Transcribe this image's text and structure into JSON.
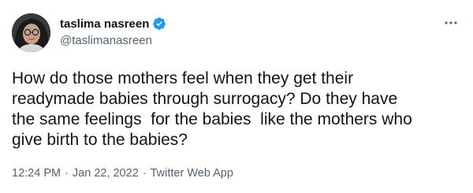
{
  "author": {
    "display_name": "taslima nasreen",
    "handle": "@taslimanasreen",
    "verified": true,
    "avatar_icon": "profile-photo",
    "verified_icon": "verified-badge-icon"
  },
  "menu": {
    "icon": "more-icon"
  },
  "tweet": {
    "text": "How do those mothers feel when they get their\nreadymade babies through surrogacy? Do they have\nthe same feelings  for the babies  like the mothers who\ngive birth to the babies?"
  },
  "meta": {
    "time": "12:24 PM",
    "separator": "·",
    "date": "Jan 22, 2022",
    "source": "Twitter Web App"
  },
  "colors": {
    "text_primary": "#0f1419",
    "text_secondary": "#536471",
    "verified_blue": "#1d9bf0",
    "background": "#ffffff"
  }
}
